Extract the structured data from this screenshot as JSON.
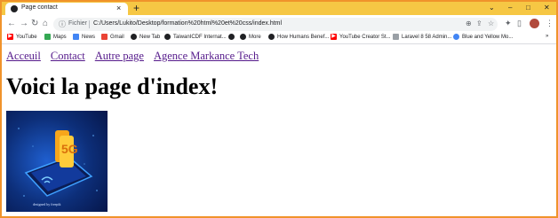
{
  "browser": {
    "tab_title": "Page contact",
    "tab_close": "×",
    "new_tab": "+",
    "controls": {
      "chevron": "⌄",
      "minimize": "–",
      "maximize": "□",
      "close": "✕"
    },
    "nav": {
      "back": "←",
      "forward": "→",
      "reload": "↻",
      "home": "⌂"
    },
    "address": {
      "info_icon": "ⓘ",
      "scheme_label": "Fichier",
      "url": "C:/Users/Lukito/Desktop/formation%20html%20et%20css/index.html"
    },
    "toolbar_icons": {
      "zoom": "⊕",
      "share": "⇪",
      "star": "☆",
      "extensions": "✦",
      "sidepanel": "▯",
      "menu": "⋮"
    },
    "bookmarks": [
      {
        "label": "YouTube",
        "icon": "youtube-icon",
        "color": "#ff0000"
      },
      {
        "label": "Maps",
        "icon": "maps-icon",
        "color": "#34a853"
      },
      {
        "label": "News",
        "icon": "news-icon",
        "color": "#4285f4"
      },
      {
        "label": "Gmail",
        "icon": "gmail-icon",
        "color": "#ea4335"
      },
      {
        "label": "New Tab",
        "icon": "globe-icon",
        "color": "#202124"
      },
      {
        "label": "TaiwanICDF Internat...",
        "icon": "globe-icon",
        "color": "#202124"
      },
      {
        "label": "",
        "icon": "globe-icon",
        "color": "#202124"
      },
      {
        "label": "More",
        "icon": "globe-icon",
        "color": "#202124"
      },
      {
        "label": "How Humans Benef...",
        "icon": "globe-icon",
        "color": "#202124"
      },
      {
        "label": "YouTube Creator St...",
        "icon": "youtube-icon",
        "color": "#ff0000"
      },
      {
        "label": "Laravel 8 58 Admin...",
        "icon": "laravel-icon",
        "color": "#9aa0a6"
      },
      {
        "label": "Blue and Yellow Mo...",
        "icon": "google-icon",
        "color": "#4285f4"
      }
    ],
    "bookmarks_overflow": "»"
  },
  "page": {
    "nav_links": [
      "Acceuil",
      "Contact",
      "Autre page",
      "Agence Markance Tech"
    ],
    "heading": "Voici la page d'index!",
    "image": {
      "badge": "5G",
      "caption": "designed by freepik"
    }
  }
}
